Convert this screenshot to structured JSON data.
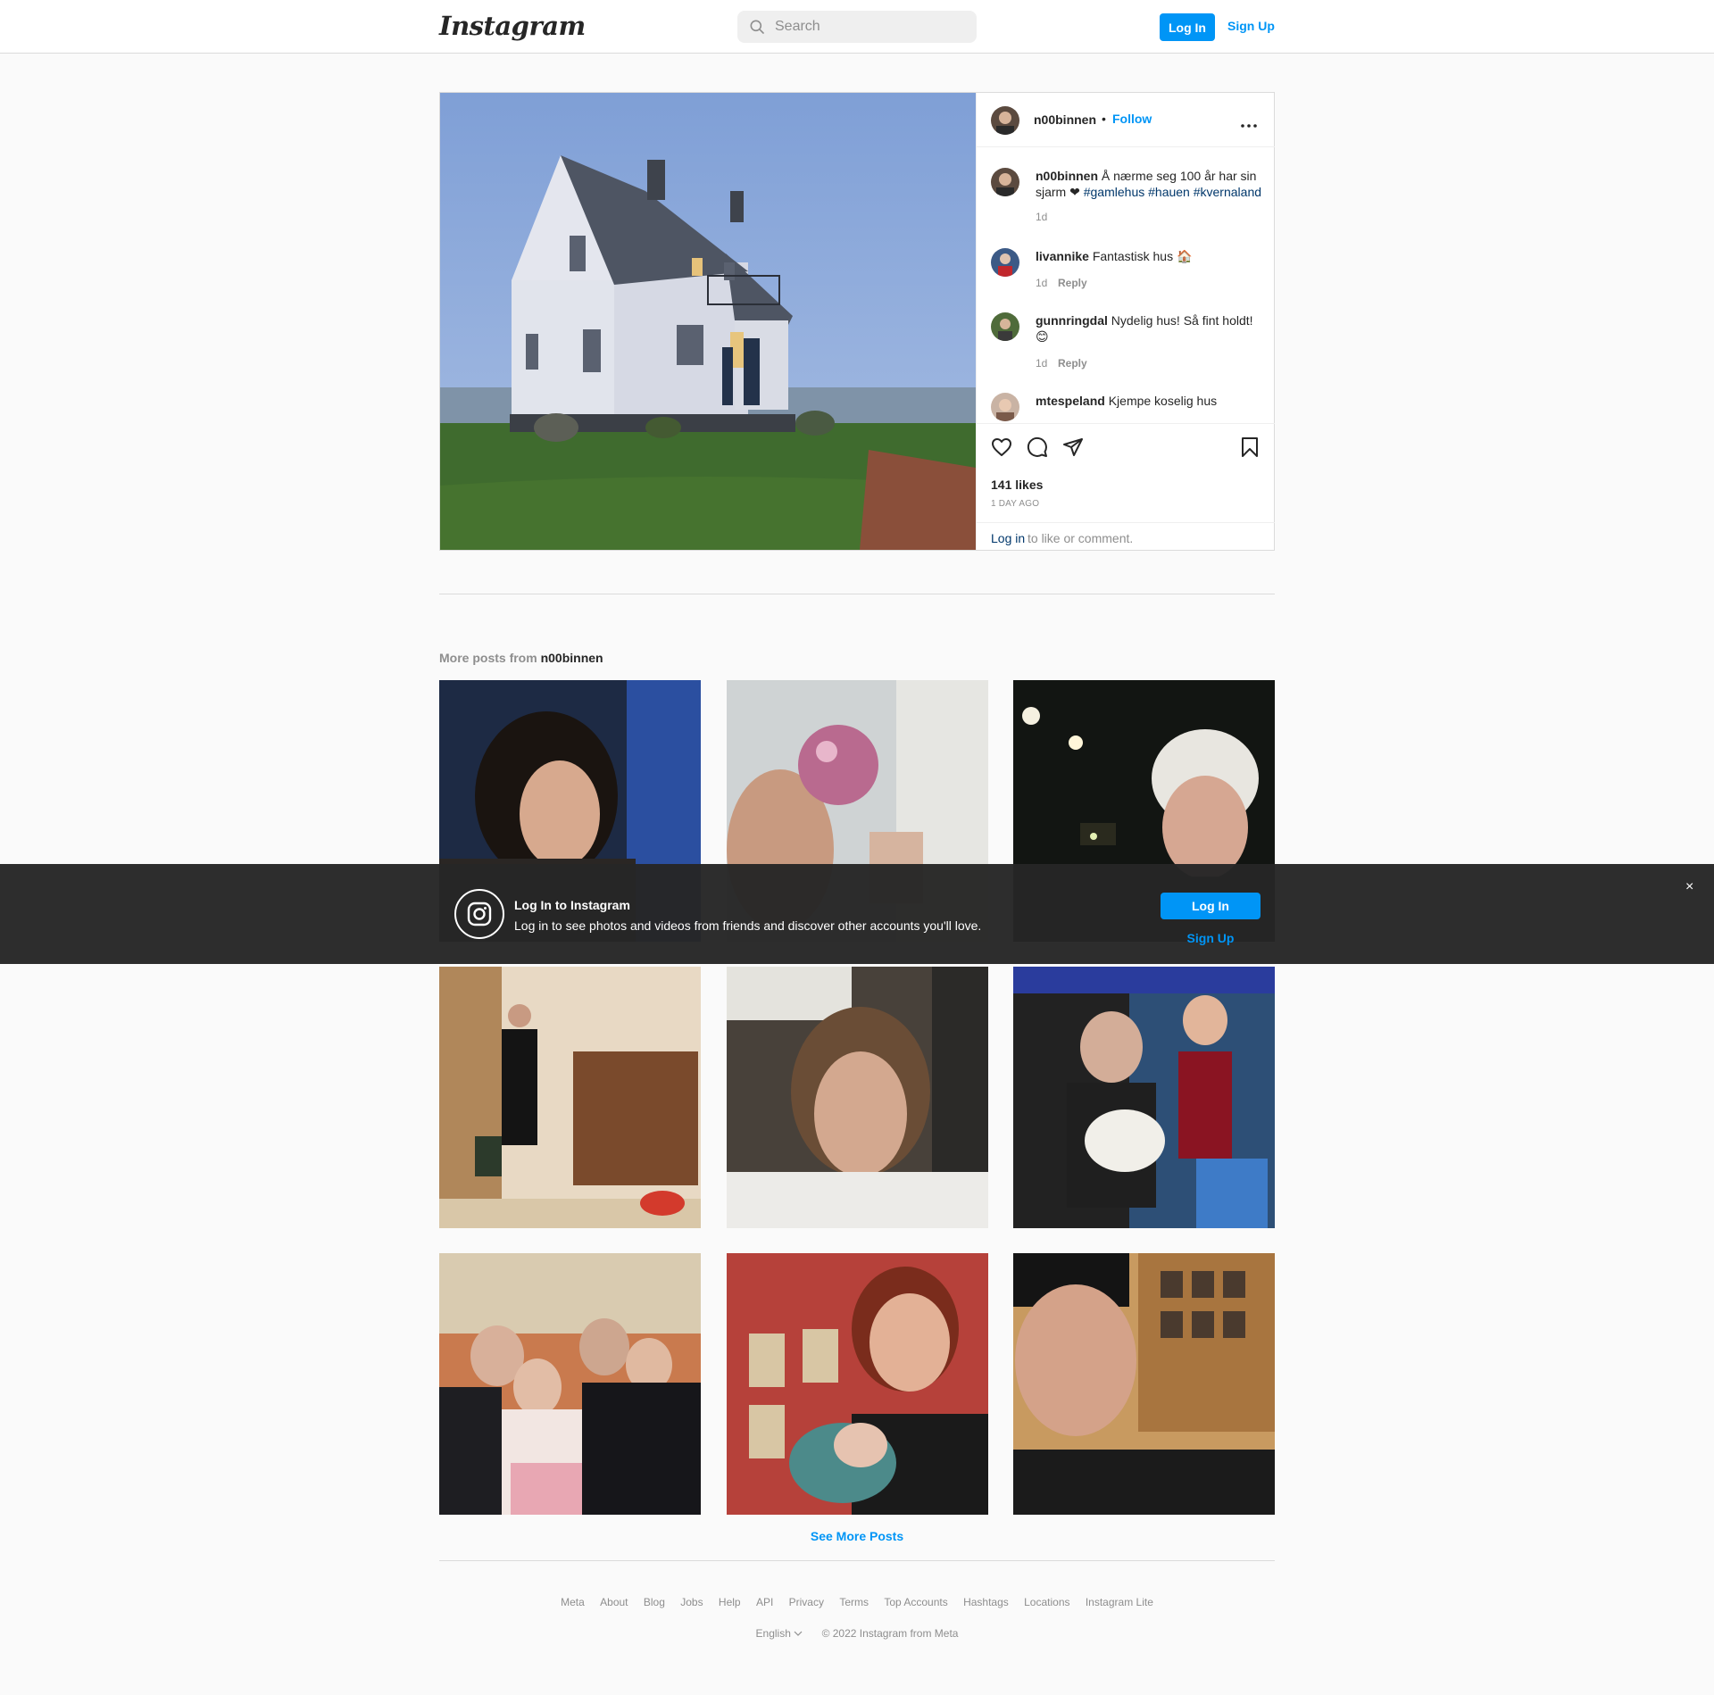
{
  "nav": {
    "logo": "Instagram",
    "search_placeholder": "Search",
    "login_label": "Log In",
    "signup_label": "Sign Up"
  },
  "post": {
    "username": "n00binnen",
    "separator": "•",
    "follow_label": "Follow",
    "caption": {
      "username": "n00binnen",
      "text": "Å nærme seg 100 år har sin sjarm ❤",
      "hashtags": [
        "#gamlehus",
        "#hauen",
        "#kvernaland"
      ],
      "time": "1d"
    },
    "comments": [
      {
        "username": "livannike",
        "text": "Fantastisk hus 🏠",
        "time": "1d",
        "reply": "Reply"
      },
      {
        "username": "gunnringdal",
        "text": "Nydelig hus! Så fint holdt! 😊",
        "time": "1d",
        "reply": "Reply"
      },
      {
        "username": "mtespeland",
        "text": "Kjempe koselig hus",
        "time": "",
        "reply": ""
      }
    ],
    "likes": "141 likes",
    "posted_ago": "1 DAY AGO",
    "login_link": "Log in",
    "login_rest": "to like or comment."
  },
  "more_posts": {
    "prefix": "More posts from",
    "owner": "n00binnen",
    "see_more": "See More Posts"
  },
  "banner": {
    "title": "Log In to Instagram",
    "subtitle": "Log in to see photos and videos from friends and discover other accounts you'll love.",
    "login_label": "Log In",
    "signup_label": "Sign Up",
    "close": "×"
  },
  "footer": {
    "links": [
      "Meta",
      "About",
      "Blog",
      "Jobs",
      "Help",
      "API",
      "Privacy",
      "Terms",
      "Top Accounts",
      "Hashtags",
      "Locations",
      "Instagram Lite"
    ],
    "language": "English",
    "copyright": "© 2022 Instagram from Meta"
  },
  "colors": {
    "accent": "#0095f6",
    "link_dark": "#00376b",
    "text": "#262626",
    "muted": "#8e8e8e",
    "border": "#dbdbdb",
    "background": "#fafafa",
    "banner": "#262626"
  },
  "icons": [
    "search-icon",
    "more-icon",
    "heart-icon",
    "comment-icon",
    "share-icon",
    "bookmark-icon",
    "instagram-glyph-icon",
    "close-icon",
    "chevron-down-icon"
  ]
}
